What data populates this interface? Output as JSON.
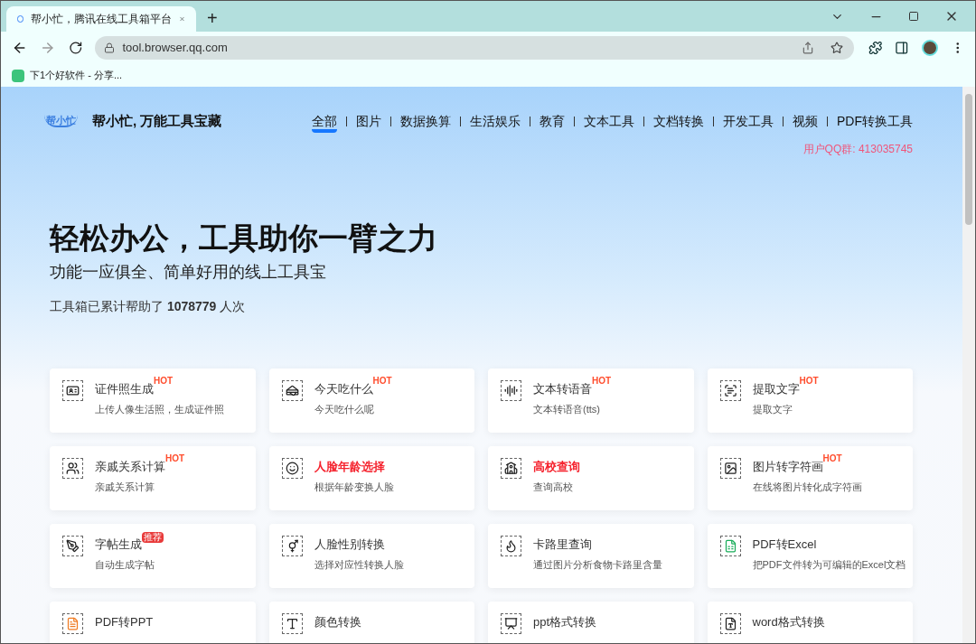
{
  "browser": {
    "tab": {
      "title": "帮小忙，腾讯在线工具箱平台",
      "selected": true
    },
    "new_tab": "+",
    "url": "tool.browser.qq.com",
    "bookmarks": [
      {
        "label": "下1个好软件 - 分享..."
      }
    ]
  },
  "site": {
    "logo": "帮小忙",
    "name": "帮小忙, 万能工具宝藏",
    "nav": [
      {
        "label": "全部",
        "selected": true
      },
      {
        "label": "图片",
        "selected": false
      },
      {
        "label": "数据换算",
        "selected": false
      },
      {
        "label": "生活娱乐",
        "selected": false
      },
      {
        "label": "教育",
        "selected": false
      },
      {
        "label": "文本工具",
        "selected": false
      },
      {
        "label": "文档转换",
        "selected": false
      },
      {
        "label": "开发工具",
        "selected": false
      },
      {
        "label": "视频",
        "selected": false
      },
      {
        "label": "PDF转换工具",
        "selected": false
      }
    ],
    "qq_group": "用户QQ群: 413035745"
  },
  "hero": {
    "title": "轻松办公，工具助你一臂之力",
    "subtitle": "功能一应俱全、简单好用的线上工具宝",
    "counter": "工具箱已累计帮助了 **1078779** 人次"
  },
  "tools": [
    {
      "title": "证件照生成",
      "badge": {
        "kind": "hot",
        "text": "HOT"
      },
      "highlighted": false,
      "description": "上传人像生活照，生成证件照"
    },
    {
      "title": "今天吃什么",
      "badge": {
        "kind": "hot",
        "text": "HOT"
      },
      "highlighted": false,
      "description": "今天吃什么呢"
    },
    {
      "title": "文本转语音",
      "badge": {
        "kind": "hot",
        "text": "HOT"
      },
      "highlighted": false,
      "description": "文本转语音(tts)"
    },
    {
      "title": "提取文字",
      "badge": {
        "kind": "hot",
        "text": "HOT"
      },
      "highlighted": false,
      "description": "提取文字"
    },
    {
      "title": "亲戚关系计算",
      "badge": {
        "kind": "hot",
        "text": "HOT"
      },
      "highlighted": false,
      "description": "亲戚关系计算"
    },
    {
      "title": "人脸年龄选择",
      "highlighted": true,
      "description": "根据年龄变换人脸"
    },
    {
      "title": "高校查询",
      "highlighted": true,
      "description": "查询高校"
    },
    {
      "title": "图片转字符画",
      "badge": {
        "kind": "hot",
        "text": "HOT"
      },
      "highlighted": false,
      "description": "在线将图片转化成字符画"
    },
    {
      "title": "字帖生成",
      "badge": {
        "kind": "tag",
        "text": "推荐"
      },
      "highlighted": false,
      "description": "自动生成字帖"
    },
    {
      "title": "人脸性别转换",
      "highlighted": false,
      "description": "选择对应性转换人脸"
    },
    {
      "title": "卡路里查询",
      "highlighted": false,
      "description": "通过图片分析食物卡路里含量"
    },
    {
      "title": "PDF转Excel",
      "highlighted": false,
      "description": "把PDF文件转为可编辑的Excel文档"
    },
    {
      "title": "PDF转PPT",
      "highlighted": false
    },
    {
      "title": "颜色转换",
      "highlighted": false
    },
    {
      "title": "ppt格式转换",
      "highlighted": false
    },
    {
      "title": "word格式转换",
      "highlighted": false
    }
  ]
}
